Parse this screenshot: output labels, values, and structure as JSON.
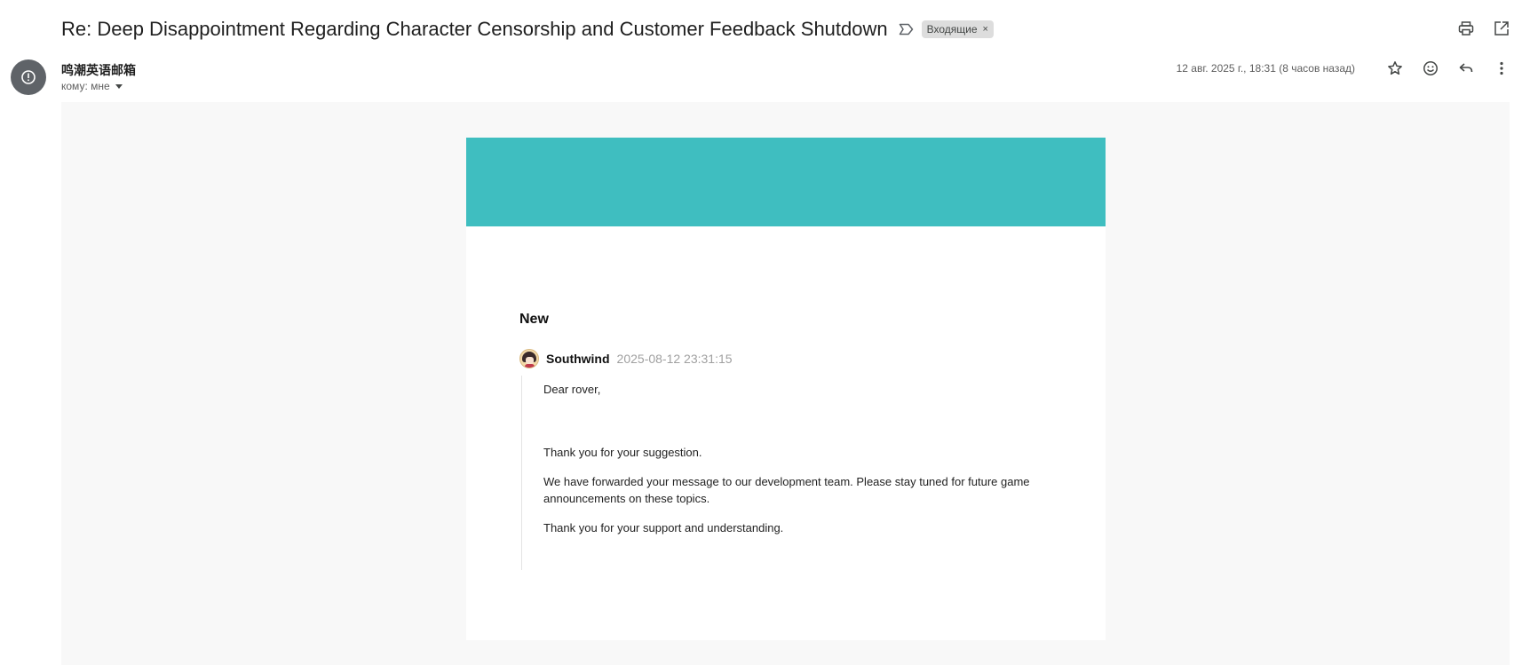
{
  "email": {
    "subject": "Re: Deep Disappointment Regarding Character Censorship and Customer Feedback Shutdown",
    "label": "Входящие",
    "label_remove": "×",
    "sender": "鸣潮英语邮箱",
    "to": "кому: мне",
    "date": "12 авг. 2025 г., 18:31 (8 часов назад)"
  },
  "colors": {
    "banner": "#3fbec0",
    "background": "#f8f8f8"
  },
  "icons": {
    "label": "label-outline-icon",
    "print": "print-icon",
    "open_new": "open-in-new-icon",
    "star": "star-icon",
    "emoji": "emoji-icon",
    "reply": "reply-icon",
    "more": "more-vert-icon",
    "avatar": "alert-circle-icon"
  },
  "message": {
    "status": "New",
    "author": "Southwind",
    "timestamp": "2025-08-12 23:31:15",
    "greeting": "Dear rover,",
    "paragraphs": [
      "Thank you for your suggestion.",
      "We have forwarded your message to our development team. Please stay tuned for future game announcements on these topics.",
      "Thank you for your support and understanding."
    ]
  }
}
